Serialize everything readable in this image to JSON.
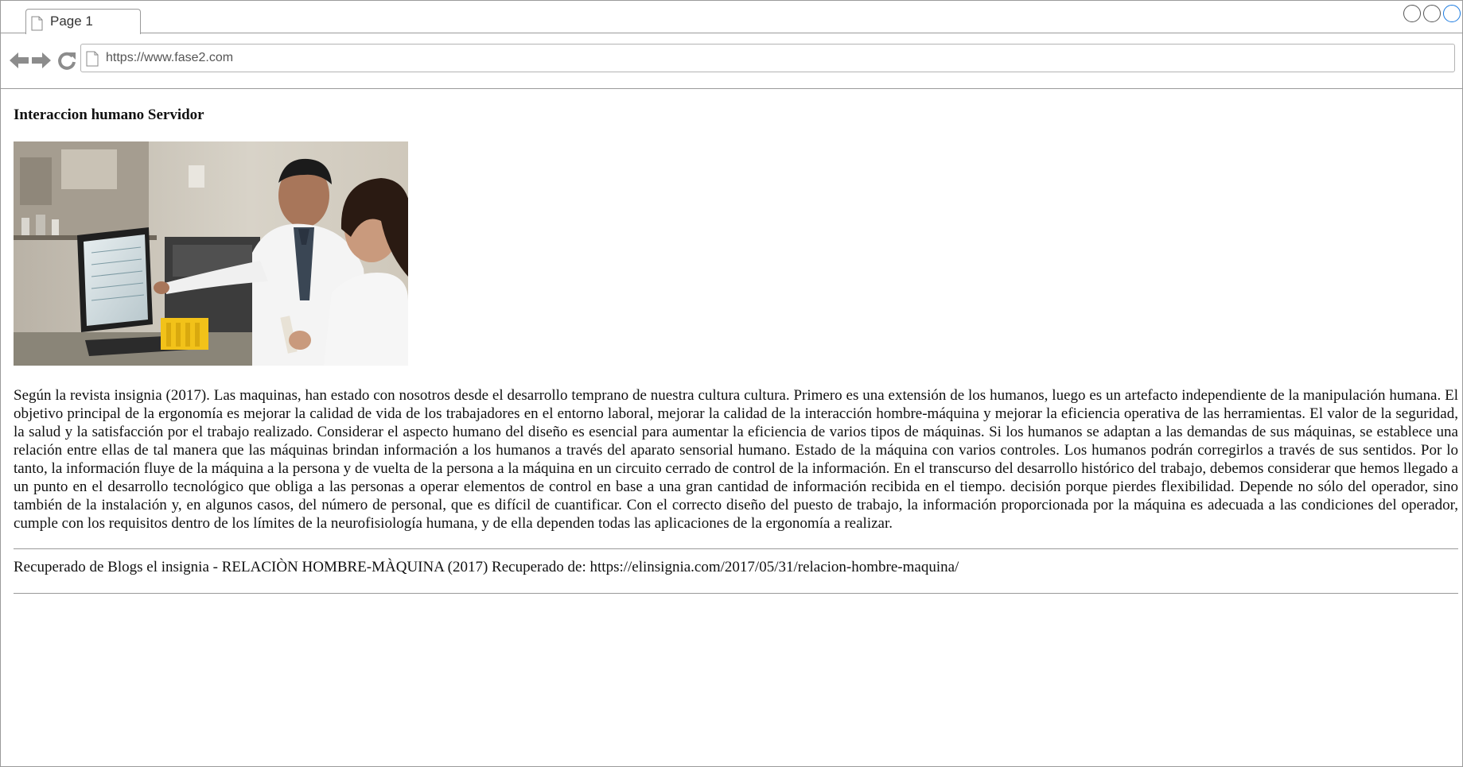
{
  "browser": {
    "tab": {
      "label": "Page 1",
      "icon": "page-icon"
    },
    "window_controls": [
      "circle",
      "circle",
      "circle"
    ],
    "nav": {
      "back_icon": "arrow-left-icon",
      "forward_icon": "arrow-right-icon",
      "reload_icon": "reload-icon"
    },
    "address_bar": {
      "url": "https://www.fase2.com",
      "icon": "page-icon"
    }
  },
  "page": {
    "title": "Interaccion humano Servidor",
    "body": "Según la revista insignia (2017). Las maquinas, han estado con nosotros desde el desarrollo temprano de nuestra cultura cultura. Primero es una extensión de los humanos, luego es un artefacto independiente de la manipulación humana. El objetivo principal de la ergonomía es mejorar la calidad de vida de los trabajadores en el entorno laboral, mejorar la calidad de la interacción hombre-máquina y mejorar la eficiencia operativa de las herramientas. El valor de la seguridad, la salud y la satisfacción por el trabajo realizado. Considerar el aspecto humano del diseño es esencial para aumentar la eficiencia de varios tipos de máquinas. Si los humanos se adaptan a las demandas de sus máquinas, se establece una relación entre ellas de tal manera que las máquinas brindan información a los humanos a través del aparato sensorial humano. Estado de la máquina con varios controles. Los humanos podrán corregirlos a través de sus sentidos. Por lo tanto, la información fluye de la máquina a la persona y de vuelta de la persona a la máquina en un circuito cerrado de control de la información. En el transcurso del desarrollo histórico del trabajo, debemos considerar que hemos llegado a un punto en el desarrollo tecnológico que obliga a las personas a operar elementos de control en base a una gran cantidad de información recibida en el tiempo. decisión porque pierdes flexibilidad. Depende no sólo del operador, sino también de la instalación y, en algunos casos, del número de personal, que es difícil de cuantificar. Con el correcto diseño del puesto de trabajo, la información proporcionada por la máquina es adecuada a las condiciones del operador, cumple con los requisitos dentro de los límites de la neurofisiología humana, y de ella dependen todas las aplicaciones de la ergonomía a realizar.",
    "citation": "Recuperado de Blogs el insignia - RELACIÒN HOMBRE-MÀQUINA (2017) Recuperado de: https://elinsignia.com/2017/05/31/relacion-hombre-maquina/"
  }
}
